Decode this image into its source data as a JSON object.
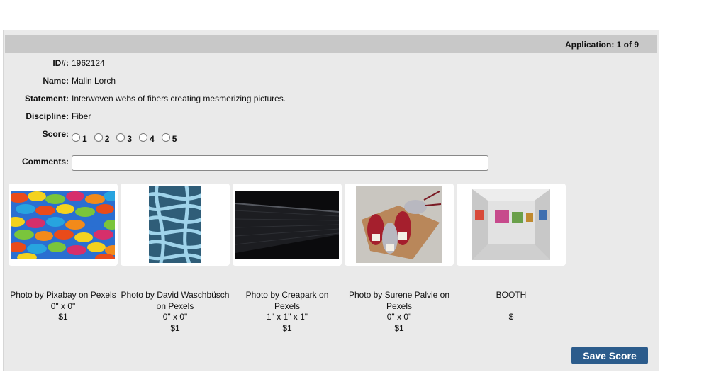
{
  "header": {
    "app_count": "Application: 1 of 9"
  },
  "fields": {
    "id": {
      "label": "ID#:",
      "value": "1962124"
    },
    "name": {
      "label": "Name:",
      "value": "Malin Lorch"
    },
    "statement": {
      "label": "Statement:",
      "value": "Interwoven webs of fibers creating mesmerizing pictures."
    },
    "discipline": {
      "label": "Discipline:",
      "value": "Fiber"
    },
    "score": {
      "label": "Score:",
      "options": [
        "1",
        "2",
        "3",
        "4",
        "5"
      ],
      "selected": null
    },
    "comments": {
      "label": "Comments:",
      "value": ""
    }
  },
  "images": [
    {
      "caption": "Photo by Pixabay on Pexels",
      "dims": "0\" x 0\"",
      "price": "$1",
      "icon": "yarn-photo"
    },
    {
      "caption": "Photo by David Waschbüsch on Pexels",
      "dims": "0\" x 0\"",
      "price": "$1",
      "icon": "rope-photo"
    },
    {
      "caption": "Photo by Creapark on Pexels",
      "dims": "1\" x 1\" x 1\"",
      "price": "$1",
      "icon": "carbon-fiber-photo"
    },
    {
      "caption": "Photo by Surene Palvie on Pexels",
      "dims": "0\" x 0\"",
      "price": "$1",
      "icon": "yarn-skeins-photo"
    },
    {
      "caption": "BOOTH",
      "dims": "",
      "price": "$",
      "icon": "booth-photo"
    }
  ],
  "actions": {
    "save_label": "Save Score"
  }
}
